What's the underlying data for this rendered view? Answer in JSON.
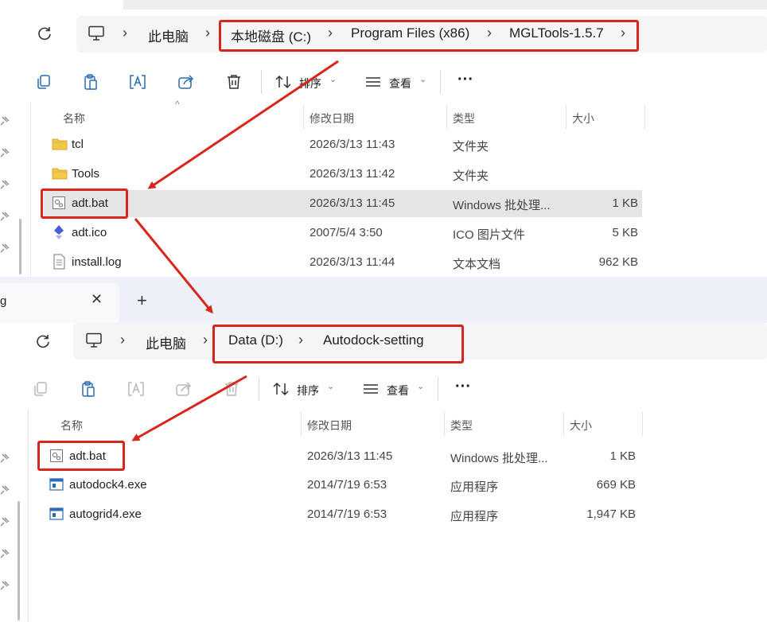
{
  "window_top": {
    "breadcrumb": [
      "此电脑",
      "本地磁盘 (C:)",
      "Program Files (x86)",
      "MGLTools-1.5.7"
    ],
    "toolbar": {
      "sort_label": "排序",
      "view_label": "查看"
    },
    "columns": [
      "名称",
      "修改日期",
      "类型",
      "大小"
    ],
    "files": [
      {
        "name": "tcl",
        "date": "2026/3/13 11:43",
        "type": "文件夹",
        "size": "",
        "icon": "folder-icon"
      },
      {
        "name": "Tools",
        "date": "2026/3/13 11:42",
        "type": "文件夹",
        "size": "",
        "icon": "folder-icon"
      },
      {
        "name": "adt.bat",
        "date": "2026/3/13 11:45",
        "type": "Windows 批处理...",
        "size": "1 KB",
        "icon": "batch-file-icon"
      },
      {
        "name": "adt.ico",
        "date": "2007/5/4 3:50",
        "type": "ICO 图片文件",
        "size": "5 KB",
        "icon": "ico-file-icon"
      },
      {
        "name": "install.log",
        "date": "2026/3/13 11:44",
        "type": "文本文档",
        "size": "962 KB",
        "icon": "text-file-icon"
      }
    ]
  },
  "window_bottom": {
    "tab_title": "g",
    "breadcrumb": [
      "此电脑",
      "Data (D:)",
      "Autodock-setting"
    ],
    "toolbar": {
      "sort_label": "排序",
      "view_label": "查看"
    },
    "columns": [
      "名称",
      "修改日期",
      "类型",
      "大小"
    ],
    "files": [
      {
        "name": "adt.bat",
        "date": "2026/3/13 11:45",
        "type": "Windows 批处理...",
        "size": "1 KB",
        "icon": "batch-file-icon"
      },
      {
        "name": "autodock4.exe",
        "date": "2014/7/19 6:53",
        "type": "应用程序",
        "size": "669 KB",
        "icon": "exe-file-icon"
      },
      {
        "name": "autogrid4.exe",
        "date": "2014/7/19 6:53",
        "type": "应用程序",
        "size": "1,947 KB",
        "icon": "exe-file-icon"
      }
    ]
  },
  "colors": {
    "annotation_red": "#d9261c",
    "selection": "#e5e5e5",
    "tabbar": "#eef0f7"
  }
}
